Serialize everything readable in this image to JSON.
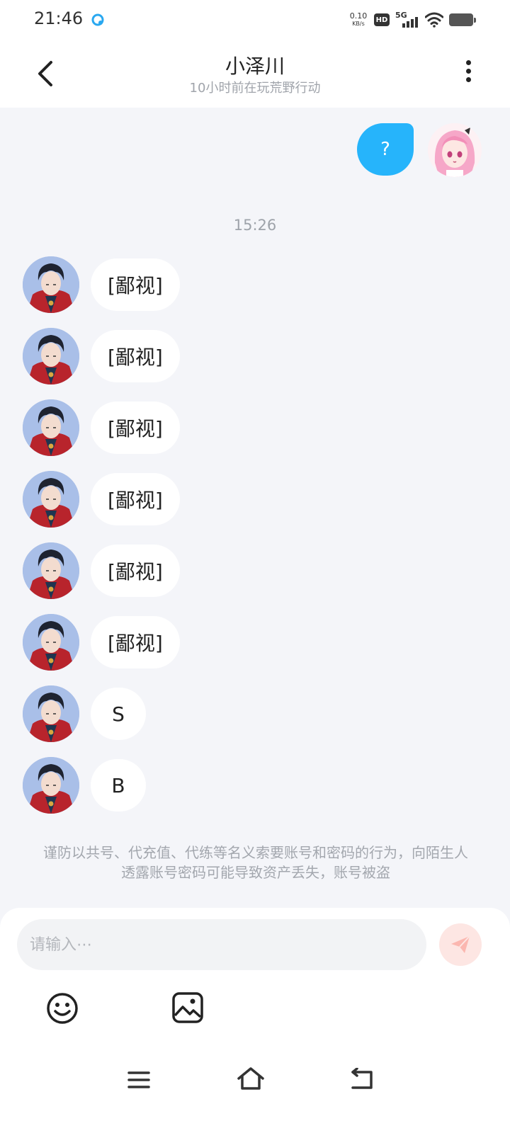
{
  "status_bar": {
    "time": "21:46",
    "net_speed_value": "0.10",
    "net_speed_unit": "KB/s",
    "hd_label": "HD",
    "network_label": "5G"
  },
  "header": {
    "title": "小泽川",
    "subtitle": "10小时前在玩荒野行动"
  },
  "chat": {
    "outgoing": [
      {
        "text": "?"
      }
    ],
    "timestamp": "15:26",
    "incoming": [
      {
        "text": "[鄙视]"
      },
      {
        "text": "[鄙视]"
      },
      {
        "text": "[鄙视]"
      },
      {
        "text": "[鄙视]"
      },
      {
        "text": "[鄙视]"
      },
      {
        "text": "[鄙视]"
      },
      {
        "text": "S"
      },
      {
        "text": "B"
      }
    ],
    "warning": "谨防以共号、代充值、代练等名义索要账号和密码的行为，向陌生人透露账号密码可能导致资产丢失，账号被盗"
  },
  "composer": {
    "placeholder": "请输入⋯",
    "value": ""
  },
  "icons": {
    "back": "chevron-left-icon",
    "more": "more-vertical-icon",
    "send": "paper-plane-icon",
    "emoji": "smiley-icon",
    "image": "image-icon",
    "nav_menu": "menu-icon",
    "nav_home": "home-icon",
    "nav_back": "back-icon"
  },
  "colors": {
    "outgoing_bubble": "#26b4fb",
    "background": "#f4f5f9",
    "send_button": "#fde6e3",
    "send_icon": "#fbb7b0"
  }
}
